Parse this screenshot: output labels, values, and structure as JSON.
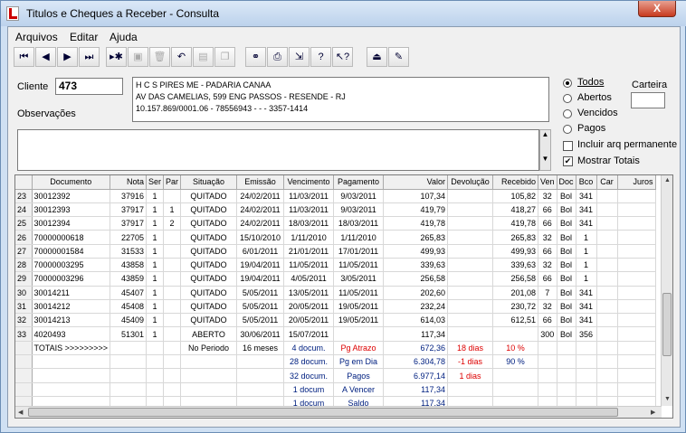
{
  "window": {
    "title": "Titulos e Cheques a Receber - Consulta",
    "close_label": "X"
  },
  "menu": [
    "Arquivos",
    "Editar",
    "Ajuda"
  ],
  "toolbar": [
    "first-icon",
    "prev-icon",
    "next-icon",
    "last-icon",
    "new-record-icon",
    "save-icon",
    "delete-icon",
    "undo-icon",
    "paste-icon",
    "copy-icon",
    "binoculars-icon",
    "print-icon",
    "export-icon",
    "help-icon",
    "whats-this-icon",
    "exit-icon",
    "report-icon"
  ],
  "cliente": {
    "label": "Cliente",
    "value": "473"
  },
  "obs_label": "Observações",
  "info": [
    "H C S PIRES ME - PADARIA CANAA",
    "AV DAS CAMELIAS,  599  ENG PASSOS - RESENDE - RJ",
    "10.157.869/0001.06  -  78556943 -                   -   -  3357-1414"
  ],
  "filters": [
    "Todos",
    "Abertos",
    "Vencidos",
    "Pagos"
  ],
  "carteira_label": "Carteira",
  "incluir_label": "Incluir arq permanente",
  "mostrar_label": "Mostrar Totais",
  "columns": [
    "Documento",
    "Nota",
    "Ser",
    "Par",
    "Situação",
    "Emissão",
    "Vencimento",
    "Pagamento",
    "Valor",
    "Devolução",
    "Recebido",
    "Ven",
    "Doc",
    "Bco",
    "Car",
    "Juros"
  ],
  "rows": [
    [
      "23",
      "30012392",
      "37916",
      "1",
      "",
      "QUITADO",
      "24/02/2011",
      "11/03/2011",
      "9/03/2011",
      "107,34",
      "",
      "105,82",
      "32",
      "Bol",
      "341"
    ],
    [
      "24",
      "30012393",
      "37917",
      "1",
      "1",
      "QUITADO",
      "24/02/2011",
      "11/03/2011",
      "9/03/2011",
      "419,79",
      "",
      "418,27",
      "66",
      "Bol",
      "341"
    ],
    [
      "25",
      "30012394",
      "37917",
      "1",
      "2",
      "QUITADO",
      "24/02/2011",
      "18/03/2011",
      "18/03/2011",
      "419,78",
      "",
      "419,78",
      "66",
      "Bol",
      "341"
    ],
    [
      "26",
      "70000000618",
      "22705",
      "1",
      "",
      "QUITADO",
      "15/10/2010",
      "1/11/2010",
      "1/11/2010",
      "265,83",
      "",
      "265,83",
      "32",
      "Bol",
      "1"
    ],
    [
      "27",
      "70000001584",
      "31533",
      "1",
      "",
      "QUITADO",
      "6/01/2011",
      "21/01/2011",
      "17/01/2011",
      "499,93",
      "",
      "499,93",
      "66",
      "Bol",
      "1"
    ],
    [
      "28",
      "70000003295",
      "43858",
      "1",
      "",
      "QUITADO",
      "19/04/2011",
      "11/05/2011",
      "11/05/2011",
      "339,63",
      "",
      "339,63",
      "32",
      "Bol",
      "1"
    ],
    [
      "29",
      "70000003296",
      "43859",
      "1",
      "",
      "QUITADO",
      "19/04/2011",
      "4/05/2011",
      "3/05/2011",
      "256,58",
      "",
      "256,58",
      "66",
      "Bol",
      "1"
    ],
    [
      "30",
      "30014211",
      "45407",
      "1",
      "",
      "QUITADO",
      "5/05/2011",
      "13/05/2011",
      "11/05/2011",
      "202,60",
      "",
      "201,08",
      "7",
      "Bol",
      "341"
    ],
    [
      "31",
      "30014212",
      "45408",
      "1",
      "",
      "QUITADO",
      "5/05/2011",
      "20/05/2011",
      "19/05/2011",
      "232,24",
      "",
      "230,72",
      "32",
      "Bol",
      "341"
    ],
    [
      "32",
      "30014213",
      "45409",
      "1",
      "",
      "QUITADO",
      "5/05/2011",
      "20/05/2011",
      "19/05/2011",
      "614,03",
      "",
      "612,51",
      "66",
      "Bol",
      "341"
    ],
    [
      "33",
      "4020493",
      "51301",
      "1",
      "",
      "ABERTO",
      "30/06/2011",
      "15/07/2011",
      "",
      "117,34",
      "",
      "",
      "300",
      "Bol",
      "356"
    ]
  ],
  "totals": {
    "label": "TOTAIS >>>>>>>>>",
    "periodo": "No Periodo",
    "meses": "16 meses",
    "lines": [
      {
        "docs": "4 docum.",
        "tipo": "Pg Atrazo",
        "valor": "672,36",
        "dev": "18 dias",
        "rec": "10 %"
      },
      {
        "docs": "28 docum.",
        "tipo": "Pg em Dia",
        "valor": "6.304,78",
        "dev": "-1 dias",
        "rec": "90 %"
      },
      {
        "docs": "32 docum.",
        "tipo": "Pagos",
        "valor": "6.977,14",
        "dev": "1 dias",
        "rec": ""
      },
      {
        "docs": "1 docum",
        "tipo": "A Vencer",
        "valor": "117,34",
        "dev": "",
        "rec": ""
      },
      {
        "docs": "1 docum",
        "tipo": "Saldo",
        "valor": "117,34",
        "dev": "",
        "rec": ""
      }
    ]
  }
}
